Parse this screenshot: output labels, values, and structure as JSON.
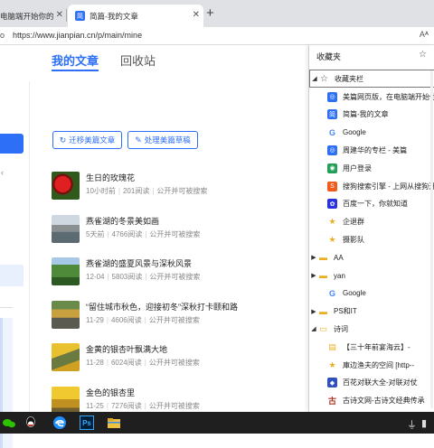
{
  "tabs": [
    {
      "title": "电脑端开始你的",
      "close": "✕"
    },
    {
      "title": "简篇-我的文章",
      "favicon": "简",
      "close": "✕"
    }
  ],
  "new_tab_label": "+",
  "address": {
    "left_glyph": "o",
    "url": "https://www.jianpian.cn/p/main/mine",
    "reader": "Aᴬ"
  },
  "left_sidebar": {
    "chevron": "‹"
  },
  "main": {
    "tab_active": "我的文章",
    "tab_inactive": "回收站",
    "migrate_btn": "迁移美篇文章",
    "drafts_btn": "处理美篇草稿",
    "migrate_icon": "↻",
    "drafts_icon": "✎"
  },
  "articles": [
    {
      "title": "生日的玫瑰花",
      "time": "10小时前",
      "reads": "201阅读",
      "status": "公开并可被搜索",
      "thumb": "rose"
    },
    {
      "title": "燕雀湖的冬景美如画",
      "time": "5天前",
      "reads": "4766阅读",
      "status": "公开并可被搜索",
      "thumb": "bridge"
    },
    {
      "title": "燕雀湖的盛夏风景与深秋风景",
      "time": "12-04",
      "reads": "5803阅读",
      "status": "公开并可被搜索",
      "thumb": "green"
    },
    {
      "title": "“留住城市秋色，迎接初冬”深秋打卡颐和路",
      "time": "11-29",
      "reads": "4606阅读",
      "status": "公开并可被搜索",
      "thumb": "road"
    },
    {
      "title": "金黄的银杏叶飘满大地",
      "time": "11-28",
      "reads": "6024阅读",
      "status": "公开并可被搜索",
      "thumb": "ginkgo"
    },
    {
      "title": "金色的银杏里",
      "time": "11-25",
      "reads": "7276阅读",
      "status": "公开并可被搜索",
      "thumb": "ginkgo2"
    }
  ],
  "favorites": {
    "header": "收藏夹",
    "add_icon": "☆",
    "bar_label": "收藏夹栏",
    "items": [
      {
        "label": "美篇网页版，在电脑端开始你的",
        "icon": "meipian",
        "arrow": ""
      },
      {
        "label": "简篇-我的文章",
        "icon": "jianpian",
        "arrow": ""
      },
      {
        "label": "Google",
        "icon": "google",
        "arrow": ""
      },
      {
        "label": "周建华的专栏 - 美篇",
        "icon": "meipian",
        "arrow": ""
      },
      {
        "label": "用户登录",
        "icon": "green-globe",
        "arrow": ""
      },
      {
        "label": "搜狗搜索引擎 - 上网从搜狗开始",
        "icon": "sogou",
        "arrow": ""
      },
      {
        "label": "百度一下，你就知道",
        "icon": "baidu",
        "arrow": ""
      },
      {
        "label": "企退群",
        "icon": "star",
        "arrow": ""
      },
      {
        "label": "摄影队",
        "icon": "star",
        "arrow": ""
      },
      {
        "label": "AA",
        "icon": "folder",
        "arrow": "▶"
      },
      {
        "label": "yan",
        "icon": "folder",
        "arrow": "▶"
      },
      {
        "label": "Google",
        "icon": "google",
        "arrow": ""
      },
      {
        "label": "PS和IT",
        "icon": "folder",
        "arrow": "▶"
      },
      {
        "label": "诗词",
        "icon": "folder-open",
        "arrow": "◢"
      },
      {
        "label": "【三十年前宴海云】-",
        "icon": "book",
        "arrow": ""
      },
      {
        "label": "庫边渔夫的空间 [http--",
        "icon": "star",
        "arrow": ""
      },
      {
        "label": "百花对联大全-对联对仗",
        "icon": "shield",
        "arrow": ""
      },
      {
        "label": "古诗文网-古诗文经典传承",
        "icon": "gushi",
        "arrow": ""
      }
    ]
  },
  "taskbar": {
    "icons": [
      "wechat-icon",
      "qq-icon",
      "edge-icon",
      "photoshop-icon",
      "file-explorer-icon"
    ],
    "ps_label": "Ps",
    "tray": [
      "usb-icon",
      "network-icon"
    ]
  }
}
